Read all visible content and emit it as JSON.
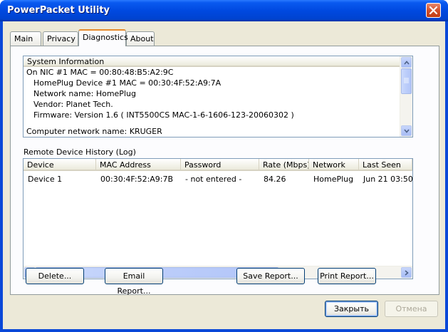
{
  "window": {
    "title": "PowerPacket Utility"
  },
  "tabs": [
    {
      "label": "Main"
    },
    {
      "label": "Privacy"
    },
    {
      "label": "Diagnostics"
    },
    {
      "label": "About"
    }
  ],
  "system_info": {
    "header": "System Information",
    "lines": [
      "On NIC #1 MAC = 00:80:48:B5:A2:9C",
      "HomePlug Device #1 MAC = 00:30:4F:52:A9:7A",
      "Network name: HomePlug",
      "Vendor: Planet Tech.",
      "Firmware: Version 1.6   ( INT5500CS MAC-1-6-1606-123-20060302 )",
      "",
      "Computer network name: KRUGER"
    ]
  },
  "history": {
    "label": "Remote Device History (Log)",
    "columns": [
      "Device",
      "MAC Address",
      "Password",
      "Rate (Mbps)",
      "Network",
      "Last Seen"
    ],
    "rows": [
      [
        "Device 1",
        "00:30:4F:52:A9:7B",
        "- not entered -",
        "84.26",
        "HomePlug",
        "Jun 21 03:50"
      ]
    ]
  },
  "actions": {
    "delete": "Delete...",
    "email": "Email Report...",
    "save": "Save Report...",
    "print": "Print Report..."
  },
  "footer": {
    "ok": "Закрыть",
    "cancel": "Отмена"
  },
  "icons": {
    "close": "close-icon",
    "scroll_up": "arrow-up-icon",
    "scroll_down": "arrow-down-icon",
    "scroll_left": "arrow-left-icon",
    "scroll_right": "arrow-right-icon"
  },
  "colors": {
    "titlebar": "#0049e0",
    "dialog_bg": "#ece9d8",
    "active_tab_accent": "#e68b2c",
    "close_button": "#d2502b"
  }
}
